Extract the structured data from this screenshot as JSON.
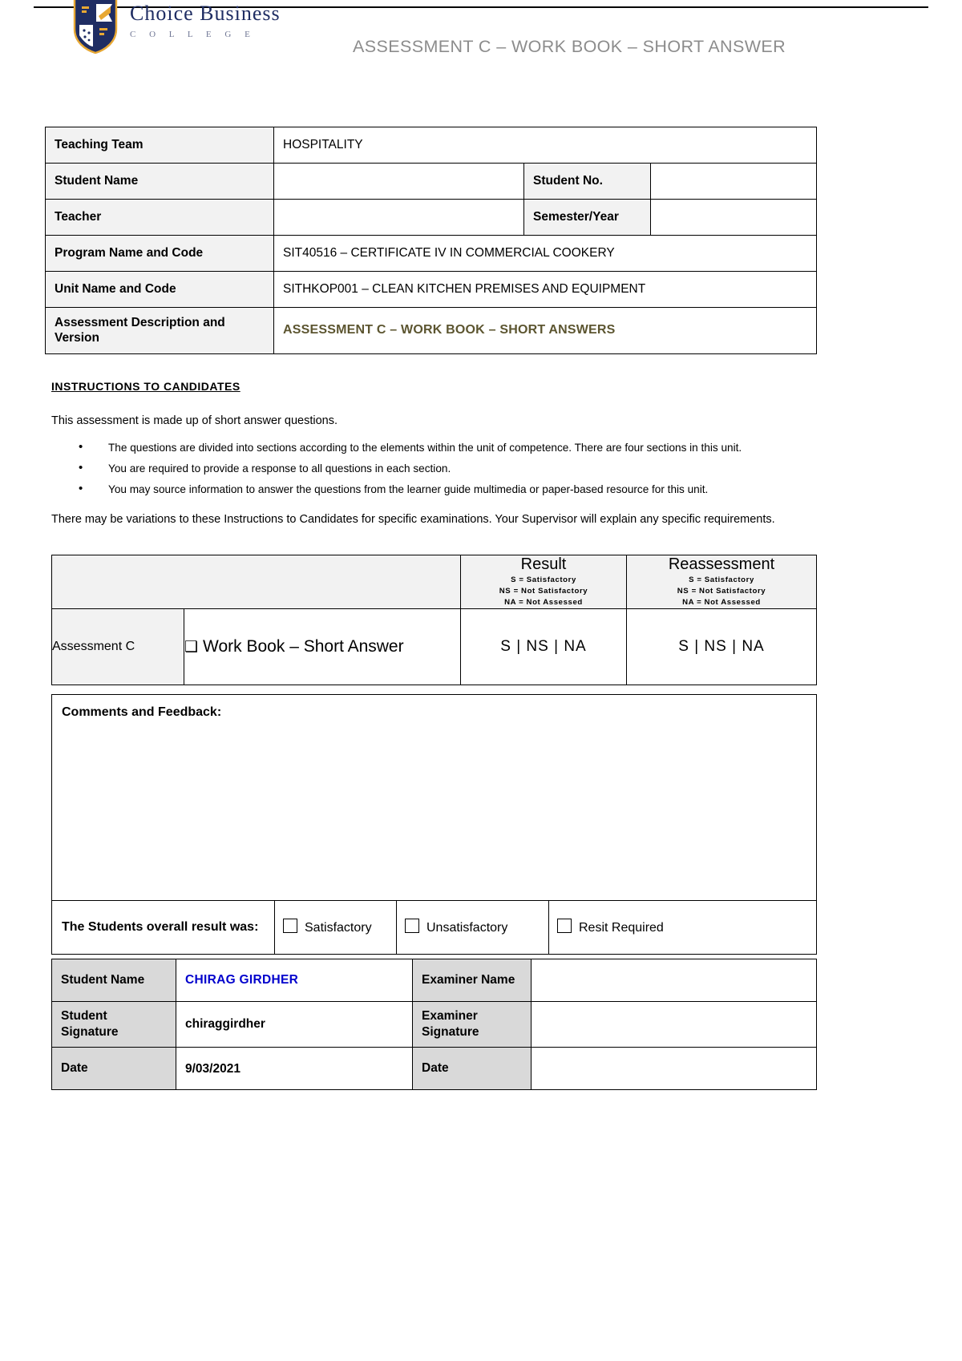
{
  "header": {
    "logo_main": "Choice Business",
    "logo_sub": "C O L L E G E",
    "title": "ASSESSMENT C – WORK BOOK – SHORT ANSWER",
    "title_color": "#8c8c8c",
    "logo_color": "#1f2d63"
  },
  "info_table": {
    "rows": [
      {
        "label": "Teaching Team",
        "value": "HOSPITALITY"
      },
      {
        "label": "Student Name",
        "value": "",
        "label2": "Student No.",
        "value2": ""
      },
      {
        "label": "Teacher",
        "value": "",
        "label2": "Semester/Year",
        "value2": ""
      },
      {
        "label": "Program Name and Code",
        "value": "SIT40516 – CERTIFICATE IV IN COMMERCIAL COOKERY"
      },
      {
        "label": "Unit Name and Code",
        "value": "SITHKOP001 – CLEAN KITCHEN PREMISES AND EQUIPMENT"
      },
      {
        "label": "Assessment Description and Version",
        "value": "ASSESSMENT C – WORK BOOK – SHORT ANSWERS"
      }
    ],
    "accent_color": "#5c5530"
  },
  "instructions": {
    "heading": "INSTRUCTIONS TO CANDIDATES",
    "intro": "This assessment is made up of short answer questions.",
    "bullets": [
      "The questions are divided into sections according to the elements within the unit of competence. There are four sections in this unit.",
      "You are required to provide a response to all questions in each section.",
      "You may source information to answer the questions from the learner guide multimedia or paper-based resource for this unit."
    ],
    "footer": "There may be variations to these Instructions to Candidates for specific examinations. Your Supervisor will explain any specific requirements."
  },
  "result_table": {
    "result_heading": "Result",
    "reassessment_heading": "Reassessment",
    "key_line_1": "S = Satisfactory",
    "key_line_2": "NS = Not Satisfactory",
    "key_line_3": "NA = Not Assessed",
    "assessment_label": "Assessment C",
    "item_checkbox": "❑",
    "item_label": "Work Book – Short Answer",
    "result_scores": "S  |  NS  |  NA",
    "reassessment_scores": "S  |  NS  |  NA"
  },
  "comments": {
    "label": "Comments and Feedback:",
    "text": "",
    "overall_label": "The Students overall result was:",
    "options": [
      {
        "label": "Satisfactory",
        "checked": false
      },
      {
        "label": "Unsatisfactory",
        "checked": false
      },
      {
        "label": "Resit Required",
        "checked": false
      }
    ]
  },
  "signature_table": {
    "rows": [
      {
        "label": "Student Name",
        "value": "CHIRAG GIRDHER",
        "label2": "Examiner Name",
        "value2": ""
      },
      {
        "label": "Student Signature",
        "value": "chiraggirdher",
        "label2": "Examiner Signature",
        "value2": ""
      },
      {
        "label": "Date",
        "value": "9/03/2021",
        "label2": "Date",
        "value2": ""
      }
    ],
    "student_name_color": "#0000cc"
  }
}
